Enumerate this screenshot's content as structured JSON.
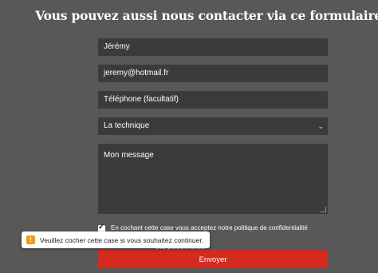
{
  "form": {
    "title": "Vous pouvez aussi nous contacter via ce formulaire :",
    "name_value": "Jérémy",
    "email_value": "jeremy@hotmail.fr",
    "phone_placeholder": "Téléphone (facultatif)",
    "subject_selected": "La technique",
    "message_placeholder": "Mon message",
    "consent_line1": "En cochant cette case vous acceptez notre politique de confidentialité relative",
    "consent_line2": "ées personnelles.",
    "submit_label": "Envoyer"
  },
  "validation_tooltip": {
    "icon": "warning-icon",
    "message": "Veuillez cocher cette case si vous souhaitez continuer."
  },
  "colors": {
    "background": "#585858",
    "field": "#3b3b3b",
    "accent": "#d52b1e",
    "warning": "#f29a16"
  }
}
